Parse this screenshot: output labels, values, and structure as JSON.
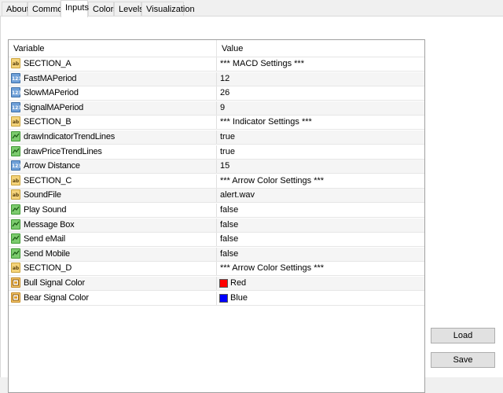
{
  "tabs": [
    {
      "label": "About",
      "active": false
    },
    {
      "label": "Common",
      "active": false
    },
    {
      "label": "Inputs",
      "active": true
    },
    {
      "label": "Colors",
      "active": false
    },
    {
      "label": "Levels",
      "active": false
    },
    {
      "label": "Visualization",
      "active": false
    }
  ],
  "grid": {
    "header_variable": "Variable",
    "header_value": "Value",
    "rows": [
      {
        "variable": "SECTION_A",
        "value": "*** MACD Settings ***",
        "type": "ab-icon"
      },
      {
        "variable": "FastMAPeriod",
        "value": "12",
        "type": "number-icon"
      },
      {
        "variable": "SlowMAPeriod",
        "value": "26",
        "type": "number-icon"
      },
      {
        "variable": "SignalMAPeriod",
        "value": "9",
        "type": "number-icon"
      },
      {
        "variable": "SECTION_B",
        "value": "*** Indicator Settings ***",
        "type": "ab-icon"
      },
      {
        "variable": "drawIndicatorTrendLines",
        "value": "true",
        "type": "bool-icon"
      },
      {
        "variable": "drawPriceTrendLines",
        "value": "true",
        "type": "bool-icon"
      },
      {
        "variable": "Arrow Distance",
        "value": "15",
        "type": "number-icon"
      },
      {
        "variable": "SECTION_C",
        "value": "*** Arrow Color Settings ***",
        "type": "ab-icon"
      },
      {
        "variable": "SoundFile",
        "value": "alert.wav",
        "type": "ab-icon"
      },
      {
        "variable": "Play Sound",
        "value": "false",
        "type": "bool-icon"
      },
      {
        "variable": "Message Box",
        "value": "false",
        "type": "bool-icon"
      },
      {
        "variable": "Send eMail",
        "value": "false",
        "type": "bool-icon"
      },
      {
        "variable": "Send Mobile",
        "value": "false",
        "type": "bool-icon"
      },
      {
        "variable": "SECTION_D",
        "value": "*** Arrow Color Settings ***",
        "type": "ab-icon"
      },
      {
        "variable": "Bull Signal Color",
        "value": "Red",
        "type": "color-icon",
        "swatch": "#ff0000"
      },
      {
        "variable": "Bear Signal Color",
        "value": "Blue",
        "type": "color-icon",
        "swatch": "#0000ff"
      }
    ]
  },
  "buttons": {
    "load_label": "Load",
    "save_label": "Save"
  }
}
